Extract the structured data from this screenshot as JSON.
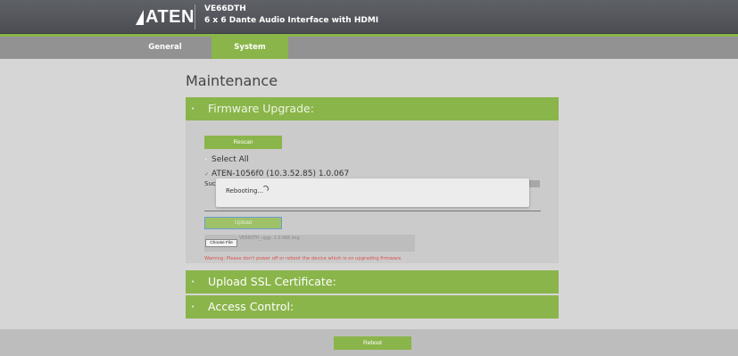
{
  "header": {
    "brand": "ATEN",
    "model": "VE66DTH",
    "subtitle": "6 x 6 Dante Audio Interface with HDMI"
  },
  "nav": {
    "tabs": [
      {
        "label": "General",
        "active": false
      },
      {
        "label": "System",
        "active": true
      }
    ]
  },
  "page": {
    "title": "Maintenance"
  },
  "firmware": {
    "header": "Firmware Upgrade:",
    "rescan_label": "Rescan",
    "select_all_label": "Select All",
    "device_label": "ATEN-1056f0 (10.3.52.85) 1.0.067",
    "status_text": "Suc",
    "dialog_text": "Rebooting...",
    "upload_label": "Upload",
    "choose_file_label": "Choose File",
    "file_name": "VE66DTH_upgr..1.0.068.img",
    "warning": "Warning: Please don't power off or reboot the device which is on upgrading firmware."
  },
  "sections": {
    "ssl": "Upload SSL Certificate:",
    "access": "Access Control:"
  },
  "footer": {
    "reboot_label": "Reboot"
  },
  "colors": {
    "accent_green": "#8ab54a",
    "header_gray": "#55575d",
    "warning_red": "#d9534f"
  }
}
